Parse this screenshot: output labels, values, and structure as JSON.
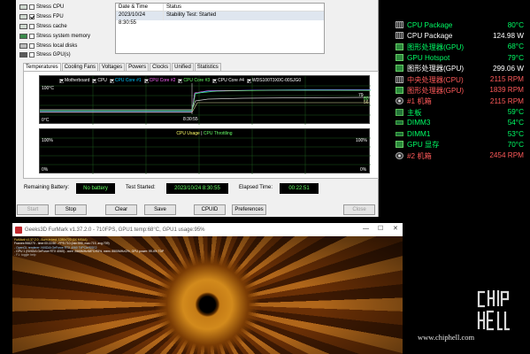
{
  "stress": {
    "items": [
      {
        "label": "Stress CPU",
        "checked": false
      },
      {
        "label": "Stress FPU",
        "checked": true
      },
      {
        "label": "Stress cache",
        "checked": false
      },
      {
        "label": "Stress system memory",
        "checked": false
      },
      {
        "label": "Stress local disks",
        "checked": false
      },
      {
        "label": "Stress GPU(s)",
        "checked": false
      }
    ]
  },
  "status": {
    "col_date": "Date & Time",
    "col_status": "Status",
    "row_date": "2023/10/24 8:30:55",
    "row_status": "Stability Test: Started"
  },
  "tabs": [
    "Temperatures",
    "Cooling Fans",
    "Voltages",
    "Powers",
    "Clocks",
    "Unified",
    "Statistics"
  ],
  "temp_graph": {
    "legend": [
      {
        "label": "Motherboard",
        "color": "#ffffff"
      },
      {
        "label": "CPU",
        "color": "#ffffff"
      },
      {
        "label": "CPU Core #1",
        "color": "#00c8ff"
      },
      {
        "label": "CPU Core #2",
        "color": "#ff66ff"
      },
      {
        "label": "CPU Core #3",
        "color": "#66ff66"
      },
      {
        "label": "CPU Core #4",
        "color": "#ffffff"
      },
      {
        "label": "WDS100T3X0C-00SJG0",
        "color": "#ffffff"
      }
    ],
    "y_top": "100°C",
    "y_bottom": "0°C",
    "x_label": "8:30:55",
    "right_values": [
      "79",
      "80",
      "56"
    ]
  },
  "cpu_graph": {
    "title_usage": "CPU Usage",
    "title_sep": "|",
    "title_throttling": "CPU Throttling",
    "y_top_left": "100%",
    "y_bottom_left": "0%",
    "y_top_right": "100%",
    "y_bottom_right": "0%"
  },
  "info": {
    "battery_label": "Remaining Battery:",
    "battery_value": "No battery",
    "started_label": "Test Started:",
    "started_value": "2023/10/24 8:30:55",
    "elapsed_label": "Elapsed Time:",
    "elapsed_value": "00:22:51"
  },
  "buttons": {
    "start": "Start",
    "stop": "Stop",
    "clear": "Clear",
    "save": "Save",
    "cpuid": "CPUID",
    "preferences": "Preferences",
    "close": "Close"
  },
  "furmark": {
    "title": "Geeks3D FurMark v1.37.2.0 - 710FPS, GPU1 temp:68°C, GPU1 usage:95%",
    "ctrl_min": "—",
    "ctrl_max": "☐",
    "ctrl_close": "✕",
    "osd": [
      "FurMark v1.37.2.0 - Burn-in test, 1280x720 (0X MSAA)",
      "Frames:966270 - time:00:22:50 - FPS:710 (min:595, max:719, avg:709)",
      "- OpenGL renderer: NVIDIA GeForce RTX 4060 Ti/PCIe/SSE2",
      "- GPU 1 (NVIDIA GeForce RTX 4060) - core: 2565MHz/68°C/95%, mem: 8500MHz/2%, GPU power: 99.4% TDP",
      "- F1: toggle help"
    ]
  },
  "sensors": [
    {
      "icon": "cpu",
      "label": "CPU Package",
      "value": "80°C",
      "color": "#00ff66"
    },
    {
      "icon": "cpu",
      "label": "CPU Package",
      "value": "124.98 W",
      "color": "#ffffff"
    },
    {
      "icon": "gpu",
      "label": "图形处理器(GPU)",
      "value": "68°C",
      "color": "#00ff66"
    },
    {
      "icon": "gpu",
      "label": "GPU Hotspot",
      "value": "79°C",
      "color": "#00ff66"
    },
    {
      "icon": "gpu",
      "label": "图形处理器(GPU)",
      "value": "299.06 W",
      "color": "#ffffff"
    },
    {
      "icon": "cpu",
      "label": "中央处理器(CPU)",
      "value": "2115 RPM",
      "color": "#ff5a5a"
    },
    {
      "icon": "gpu",
      "label": "图形处理器(GPU)",
      "value": "1839 RPM",
      "color": "#ff5a5a"
    },
    {
      "icon": "fan",
      "label": "#1 机箱",
      "value": "2115 RPM",
      "color": "#ff5a5a"
    },
    {
      "icon": "mb",
      "label": "主板",
      "value": "59°C",
      "color": "#00ff66"
    },
    {
      "icon": "mem",
      "label": "DIMM3",
      "value": "54°C",
      "color": "#00ff66"
    },
    {
      "icon": "mem",
      "label": "DIMM1",
      "value": "53°C",
      "color": "#00ff66"
    },
    {
      "icon": "gpu",
      "label": "GPU 显存",
      "value": "70°C",
      "color": "#00ff66"
    },
    {
      "icon": "fan",
      "label": "#2 机箱",
      "value": "2454 RPM",
      "color": "#ff5a5a"
    }
  ],
  "watermark": {
    "url": "www.chiphell.com",
    "logo_text": "chip hell"
  }
}
